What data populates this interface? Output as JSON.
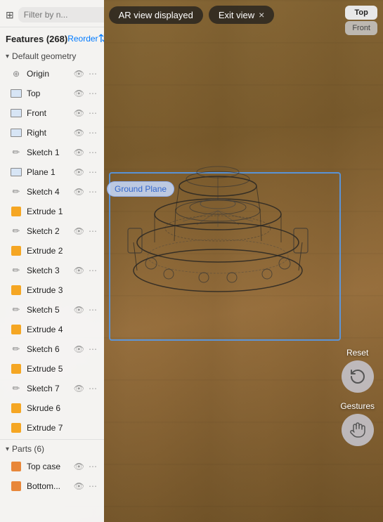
{
  "topBar": {
    "arBadgeLabel": "AR view displayed",
    "exitBtnLabel": "Exit view",
    "closeIcon": "×"
  },
  "viewControls": {
    "topBtn": "Top",
    "frontBtn": "Front"
  },
  "panel": {
    "filterIcon": "⊞",
    "searchPlaceholder": "Filter by n...",
    "featuresTitle": "Features",
    "featuresCount": "(268)",
    "reorderLabel": "Reorder",
    "reorderIcon": "⇅",
    "sectionLabel": "Default geometry",
    "items": [
      {
        "icon": "origin",
        "name": "Origin"
      },
      {
        "icon": "plane",
        "name": "Top"
      },
      {
        "icon": "plane",
        "name": "Front"
      },
      {
        "icon": "plane",
        "name": "Right"
      },
      {
        "icon": "pencil",
        "name": "Sketch 1"
      },
      {
        "icon": "plane",
        "name": "Plane 1"
      },
      {
        "icon": "pencil",
        "name": "Sketch 4"
      },
      {
        "icon": "extrude",
        "name": "Extrude 1"
      },
      {
        "icon": "pencil",
        "name": "Sketch 2"
      },
      {
        "icon": "extrude",
        "name": "Extrude 2"
      },
      {
        "icon": "pencil",
        "name": "Sketch 3"
      },
      {
        "icon": "extrude",
        "name": "Extrude 3"
      },
      {
        "icon": "pencil",
        "name": "Sketch 5"
      },
      {
        "icon": "extrude",
        "name": "Extrude 4"
      },
      {
        "icon": "pencil",
        "name": "Sketch 6"
      },
      {
        "icon": "extrude",
        "name": "Extrude 5"
      },
      {
        "icon": "pencil",
        "name": "Sketch 7"
      },
      {
        "icon": "extrude",
        "name": "Skrude 6"
      },
      {
        "icon": "extrude",
        "name": "Extrude 7"
      }
    ],
    "parts": {
      "label": "Parts",
      "count": "(6)",
      "items": [
        {
          "name": "Top case",
          "visible": true
        },
        {
          "name": "Bottom...",
          "visible": true
        }
      ]
    }
  },
  "groundLabel": "Ground Plane",
  "rightControls": {
    "resetLabel": "Reset",
    "resetIcon": "↺",
    "gesturesLabel": "Gestures",
    "gesturesIcon": "✋"
  }
}
